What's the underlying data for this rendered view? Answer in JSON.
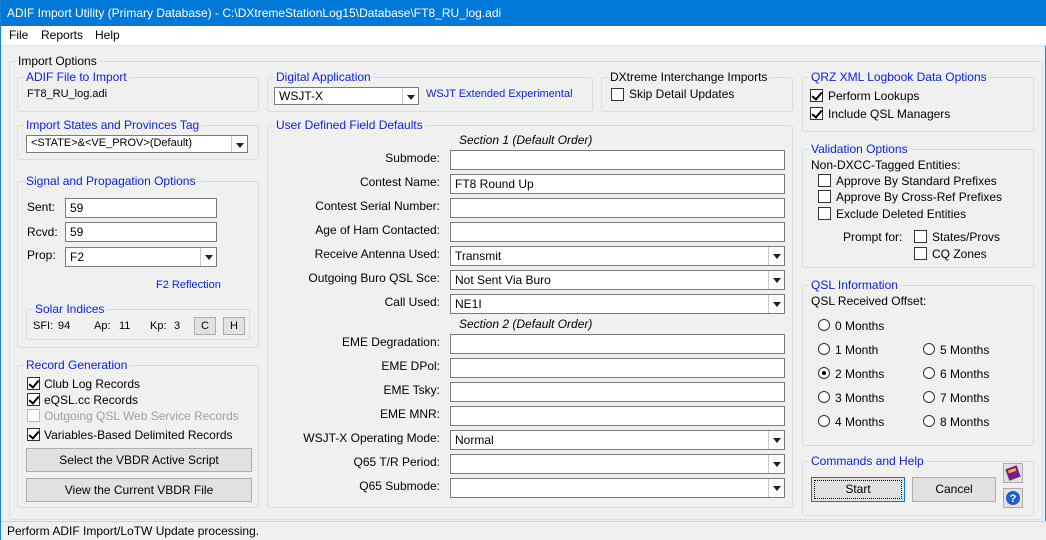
{
  "window": {
    "title": "ADIF Import Utility (Primary Database)  - C:\\DXtremeStationLog15\\Database\\FT8_RU_log.adi"
  },
  "menu": [
    "File",
    "Reports",
    "Help"
  ],
  "import_options": {
    "legend": "Import Options"
  },
  "adif_file": {
    "legend": "ADIF File to Import",
    "filename": "FT8_RU_log.adi"
  },
  "digital_app": {
    "legend": "Digital Application",
    "value": "WSJT-X",
    "link": "WSJT Extended Experimental"
  },
  "interchange": {
    "legend": "DXtreme Interchange Imports",
    "skip_label": "Skip Detail Updates",
    "skip_checked": false
  },
  "qrz": {
    "legend": "QRZ XML Logbook Data Options",
    "perform_label": "Perform Lookups",
    "perform_checked": true,
    "include_label": "Include QSL Managers",
    "include_checked": true
  },
  "states": {
    "legend": "Import States and Provinces Tag",
    "value": "<STATE>&<VE_PROV>(Default)"
  },
  "signal": {
    "legend": "Signal and Propagation Options",
    "sent_label": "Sent:",
    "sent_value": "59",
    "rcvd_label": "Rcvd:",
    "rcvd_value": "59",
    "prop_label": "Prop:",
    "prop_value": "F2",
    "prop_desc": "F2 Reflection"
  },
  "solar": {
    "legend": "Solar Indices",
    "sfi_label": "SFI:",
    "sfi_value": "94",
    "ap_label": "Ap:",
    "ap_value": "11",
    "kp_label": "Kp:",
    "kp_value": "3",
    "c_label": "C",
    "h_label": "H"
  },
  "record": {
    "legend": "Record Generation",
    "items": [
      {
        "label": "Club Log Records",
        "checked": true,
        "enabled": true
      },
      {
        "label": "eQSL.cc Records",
        "checked": true,
        "enabled": true
      },
      {
        "label": "Outgoing QSL Web Service Records",
        "checked": false,
        "enabled": false
      },
      {
        "label": "Variables-Based Delimited Records",
        "checked": true,
        "enabled": true
      }
    ],
    "select_button": "Select the VBDR Active Script",
    "view_button": "View the Current VBDR File"
  },
  "udf": {
    "legend": "User Defined Field Defaults",
    "section1": "Section 1 (Default Order)",
    "section2": "Section 2 (Default Order)",
    "fields": [
      {
        "label": "Submode:",
        "value": ""
      },
      {
        "label": "Contest Name:",
        "value": "FT8 Round Up"
      },
      {
        "label": "Contest Serial Number:",
        "value": ""
      },
      {
        "label": "Age of Ham Contacted:",
        "value": ""
      },
      {
        "label": "Receive Antenna Used:",
        "value": "Transmit"
      },
      {
        "label": "Outgoing Buro QSL Sce:",
        "value": "Not Sent Via Buro"
      },
      {
        "label": "Call Used:",
        "value": "NE1I"
      },
      {
        "label": "EME Degradation:",
        "value": ""
      },
      {
        "label": "EME DPol:",
        "value": ""
      },
      {
        "label": "EME Tsky:",
        "value": ""
      },
      {
        "label": "EME MNR:",
        "value": ""
      },
      {
        "label": "WSJT-X Operating Mode:",
        "value": "Normal"
      },
      {
        "label": "Q65 T/R Period:",
        "value": ""
      },
      {
        "label": "Q65 Submode:",
        "value": ""
      }
    ]
  },
  "validation": {
    "legend": "Validation Options",
    "subtitle": "Non-DXCC-Tagged Entities:",
    "items": [
      {
        "label": "Approve By Standard Prefixes",
        "checked": false
      },
      {
        "label": "Approve By Cross-Ref Prefixes",
        "checked": false
      },
      {
        "label": "Exclude Deleted Entities",
        "checked": false
      }
    ],
    "prompt_label": "Prompt for:",
    "prompt_items": [
      {
        "label": "States/Provs",
        "checked": false
      },
      {
        "label": "CQ Zones",
        "checked": false
      }
    ]
  },
  "qsl": {
    "legend": "QSL Information",
    "subtitle": "QSL Received Offset:",
    "options": [
      "0 Months",
      "1 Month",
      "2 Months",
      "3 Months",
      "4 Months",
      "5 Months",
      "6 Months",
      "7 Months",
      "8 Months"
    ],
    "selected": "2 Months"
  },
  "commands": {
    "legend": "Commands and Help",
    "start": "Start",
    "cancel": "Cancel"
  },
  "status": "Perform ADIF Import/LoTW Update processing."
}
